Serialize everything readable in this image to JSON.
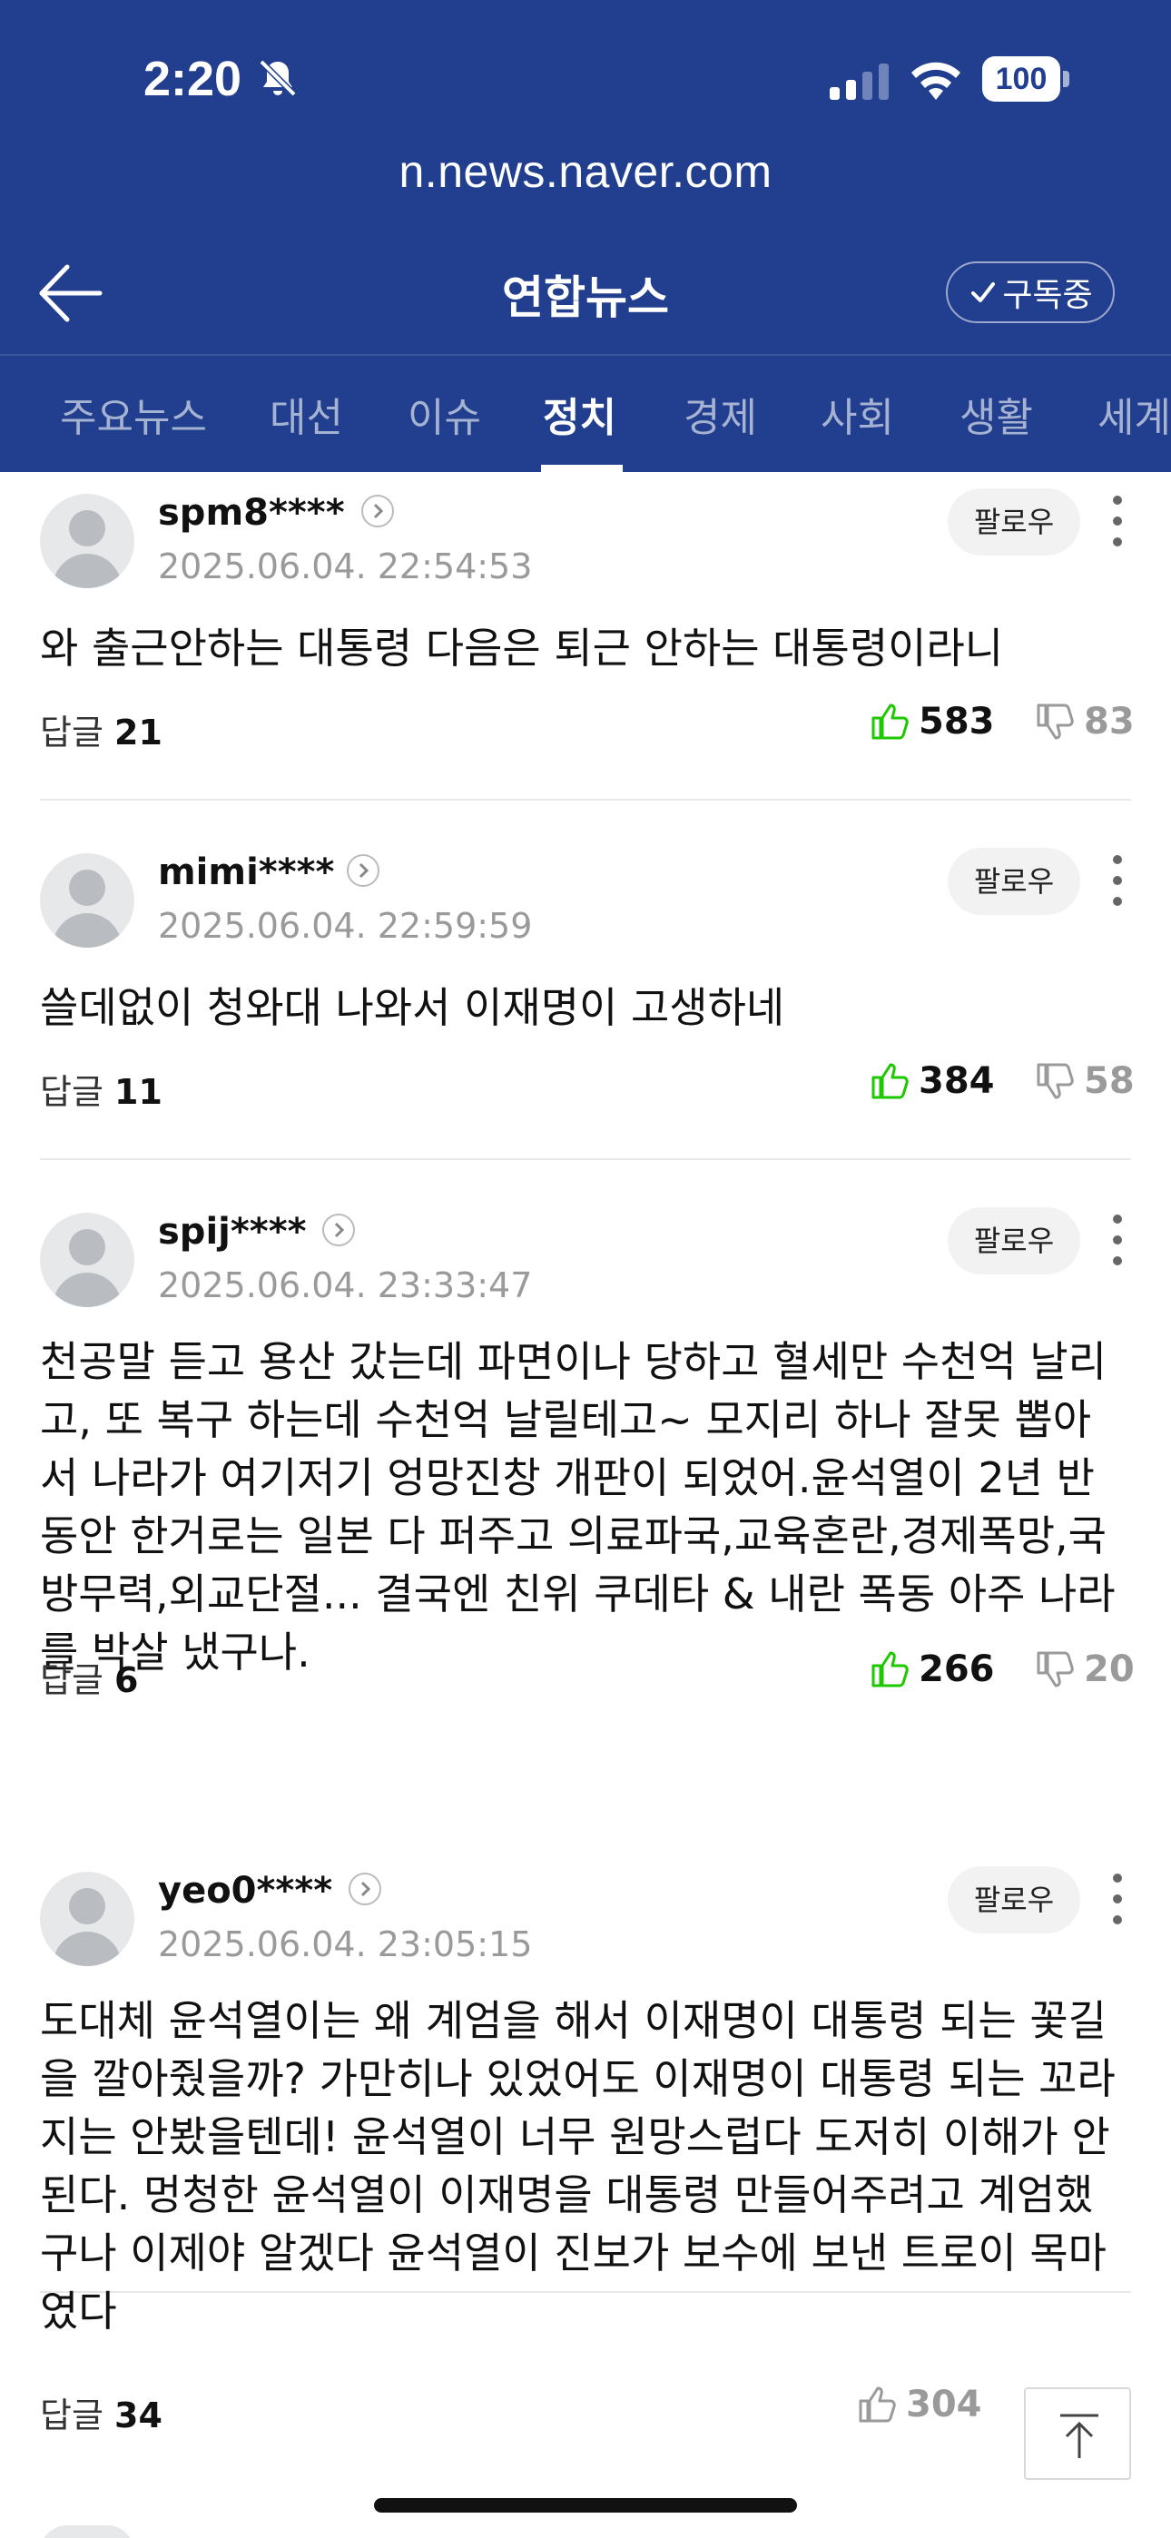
{
  "status_bar": {
    "time": "2:20",
    "battery": "100"
  },
  "browser": {
    "url": "n.news.naver.com"
  },
  "header": {
    "press_name": "연합뉴스",
    "subscribe_label": "구독중"
  },
  "tabs": [
    {
      "label": "주요뉴스",
      "active": false
    },
    {
      "label": "대선",
      "active": false
    },
    {
      "label": "이슈",
      "active": false
    },
    {
      "label": "정치",
      "active": true
    },
    {
      "label": "경제",
      "active": false
    },
    {
      "label": "사회",
      "active": false
    },
    {
      "label": "생활",
      "active": false
    },
    {
      "label": "세계",
      "active": false
    }
  ],
  "comments": [
    {
      "user": "spm8****",
      "date": "2025.06.04. 22:54:53",
      "follow_label": "팔로우",
      "text": "와 출근안하는 대통령 다음은 퇴근 안하는 대통령이라니",
      "reply_label": "답글",
      "reply_count": "21",
      "likes": "583",
      "dislikes": "83"
    },
    {
      "user": "mimi****",
      "date": "2025.06.04. 22:59:59",
      "follow_label": "팔로우",
      "text": "쓸데없이 청와대 나와서 이재명이 고생하네",
      "reply_label": "답글",
      "reply_count": "11",
      "likes": "384",
      "dislikes": "58"
    },
    {
      "user": "spij****",
      "date": "2025.06.04. 23:33:47",
      "follow_label": "팔로우",
      "text": "천공말 듣고 용산 갔는데 파면이나 당하고 혈세만 수천억 날리고, 또 복구 하는데 수천억 날릴테고~ 모지리 하나 잘못 뽑아서 나라가 여기저기 엉망진창 개판이 되었어.윤석열이 2년 반 동안 한거로는 일본 다 퍼주고 의료파국,교육혼란,경제폭망,국방무력,외교단절... 결국엔 친위 쿠데타 & 내란 폭동 아주 나라를 박살 냈구나.",
      "reply_label": "답글",
      "reply_count": "6",
      "likes": "266",
      "dislikes": "20"
    },
    {
      "user": "yeo0****",
      "date": "2025.06.04. 23:05:15",
      "follow_label": "팔로우",
      "text": "도대체 윤석열이는 왜 계엄을 해서 이재명이 대통령 되는 꽃길을 깔아줬을까? 가만히나 있었어도 이재명이 대통령 되는 꼬라지는 안봤을텐데! 윤석열이 너무 원망스럽다 도저히 이해가 안된다. 멍청한 윤석열이 이재명을 대통령 만들어주려고 계엄했구나 이제야 알겠다 윤석열이 진보가 보수에 보낸 트로이 목마였다",
      "reply_label": "답글",
      "reply_count": "34",
      "likes": "304"
    }
  ],
  "colors": {
    "header_bg": "#213f8e",
    "like_green": "#1ec800"
  },
  "icons": [
    "bell-slash-icon",
    "signal-icon",
    "wifi-icon",
    "back-arrow-icon",
    "check-icon",
    "chevron-right-icon",
    "more-vertical-icon",
    "thumbs-up-icon",
    "thumbs-down-icon",
    "arrow-up-icon"
  ]
}
